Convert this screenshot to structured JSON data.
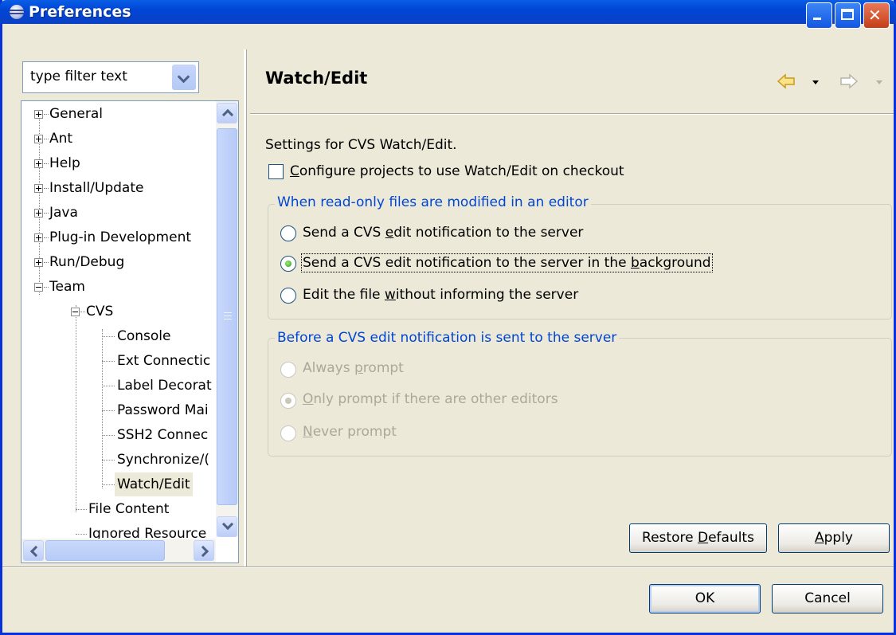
{
  "window": {
    "title": "Preferences"
  },
  "filter": {
    "placeholder": "type filter text"
  },
  "tree": {
    "items": [
      {
        "label": "General"
      },
      {
        "label": "Ant"
      },
      {
        "label": "Help"
      },
      {
        "label": "Install/Update"
      },
      {
        "label": "Java"
      },
      {
        "label": "Plug-in Development"
      },
      {
        "label": "Run/Debug"
      },
      {
        "label": "Team"
      },
      {
        "label": "CVS"
      },
      {
        "label": "Console"
      },
      {
        "label": "Ext Connectic"
      },
      {
        "label": "Label Decorat"
      },
      {
        "label": "Password Mai"
      },
      {
        "label": "SSH2 Connec"
      },
      {
        "label": "Synchronize/("
      },
      {
        "label": "Watch/Edit"
      },
      {
        "label": "File Content"
      },
      {
        "label": "Ignored Resource"
      }
    ]
  },
  "page": {
    "title": "Watch/Edit",
    "description": "Settings for CVS Watch/Edit.",
    "configure_checkbox": {
      "label_pre": "",
      "mnemonic": "C",
      "label_post": "onfigure projects to use Watch/Edit on checkout",
      "checked": false
    },
    "group1": {
      "title": "When read-only files are modified in an editor",
      "options": [
        {
          "pre": "Send a CVS ",
          "mnemonic": "e",
          "post": "dit notification to the server",
          "checked": false
        },
        {
          "pre": "Send a CVS edit notification to the server in the ",
          "mnemonic": "b",
          "post": "ackground",
          "checked": true
        },
        {
          "pre": "Edit the file ",
          "mnemonic": "w",
          "post": "ithout informing the server",
          "checked": false
        }
      ]
    },
    "group2": {
      "title": "Before a CVS edit notification is sent to the server",
      "options": [
        {
          "pre": "Always ",
          "mnemonic": "p",
          "post": "rompt",
          "checked": false
        },
        {
          "pre": "",
          "mnemonic": "O",
          "post": "nly prompt if there are other editors",
          "checked": true
        },
        {
          "pre": "",
          "mnemonic": "N",
          "post": "ever prompt",
          "checked": false
        }
      ]
    },
    "restore_defaults": {
      "pre": "Restore ",
      "mnemonic": "D",
      "post": "efaults"
    },
    "apply": {
      "pre": "",
      "mnemonic": "A",
      "post": "pply"
    }
  },
  "dialog": {
    "ok_label": "OK",
    "cancel_label": "Cancel"
  },
  "icons": {
    "back": "back-arrow-icon",
    "forward": "forward-arrow-icon"
  },
  "colors": {
    "titlebar": "#0046d5",
    "group_title": "#0046d5",
    "background": "#ece9d8"
  }
}
